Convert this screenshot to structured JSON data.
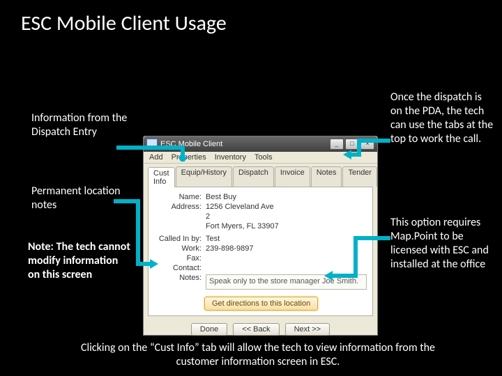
{
  "title": "ESC Mobile Client Usage",
  "annotations": {
    "left1": "Information from the Dispatch Entry",
    "left2": "Permanent location notes",
    "left3_label": "Note: ",
    "left3_body": "The tech cannot modify information on this screen",
    "right1": "Once the dispatch is on the PDA, the tech can use the tabs at the top to work the call.",
    "right2": "This option requires Map.Point to be licensed with ESC and installed at the office"
  },
  "caption": "Clicking on the “Cust Info” tab will allow the tech to view information from the customer information screen in ESC.",
  "window": {
    "title": "ESC Mobile Client",
    "menu": [
      "Add",
      "Properties",
      "Inventory",
      "Tools"
    ],
    "tabs": [
      "Cust Info",
      "Equip/History",
      "Dispatch",
      "Invoice",
      "Notes",
      "Tender"
    ],
    "active_tab": "Cust Info",
    "fields": {
      "name_label": "Name:",
      "name": "Best Buy",
      "address_label": "Address:",
      "addr1": "1256 Cleveland Ave",
      "addr2": "2",
      "addr3": "Fort Myers, FL  33907",
      "calledin_label": "Called In by:",
      "calledin": "Test",
      "work_label": "Work:",
      "work": "239-898-9897",
      "fax_label": "Fax:",
      "fax": "",
      "contact_label": "Contact:",
      "contact": "",
      "notes_label": "Notes:",
      "notes": "Speak only to the store manager Joe Smith."
    },
    "dir_button": "Get directions to this location",
    "buttons": {
      "done": "Done",
      "back": "<< Back",
      "next": "Next >>"
    }
  }
}
